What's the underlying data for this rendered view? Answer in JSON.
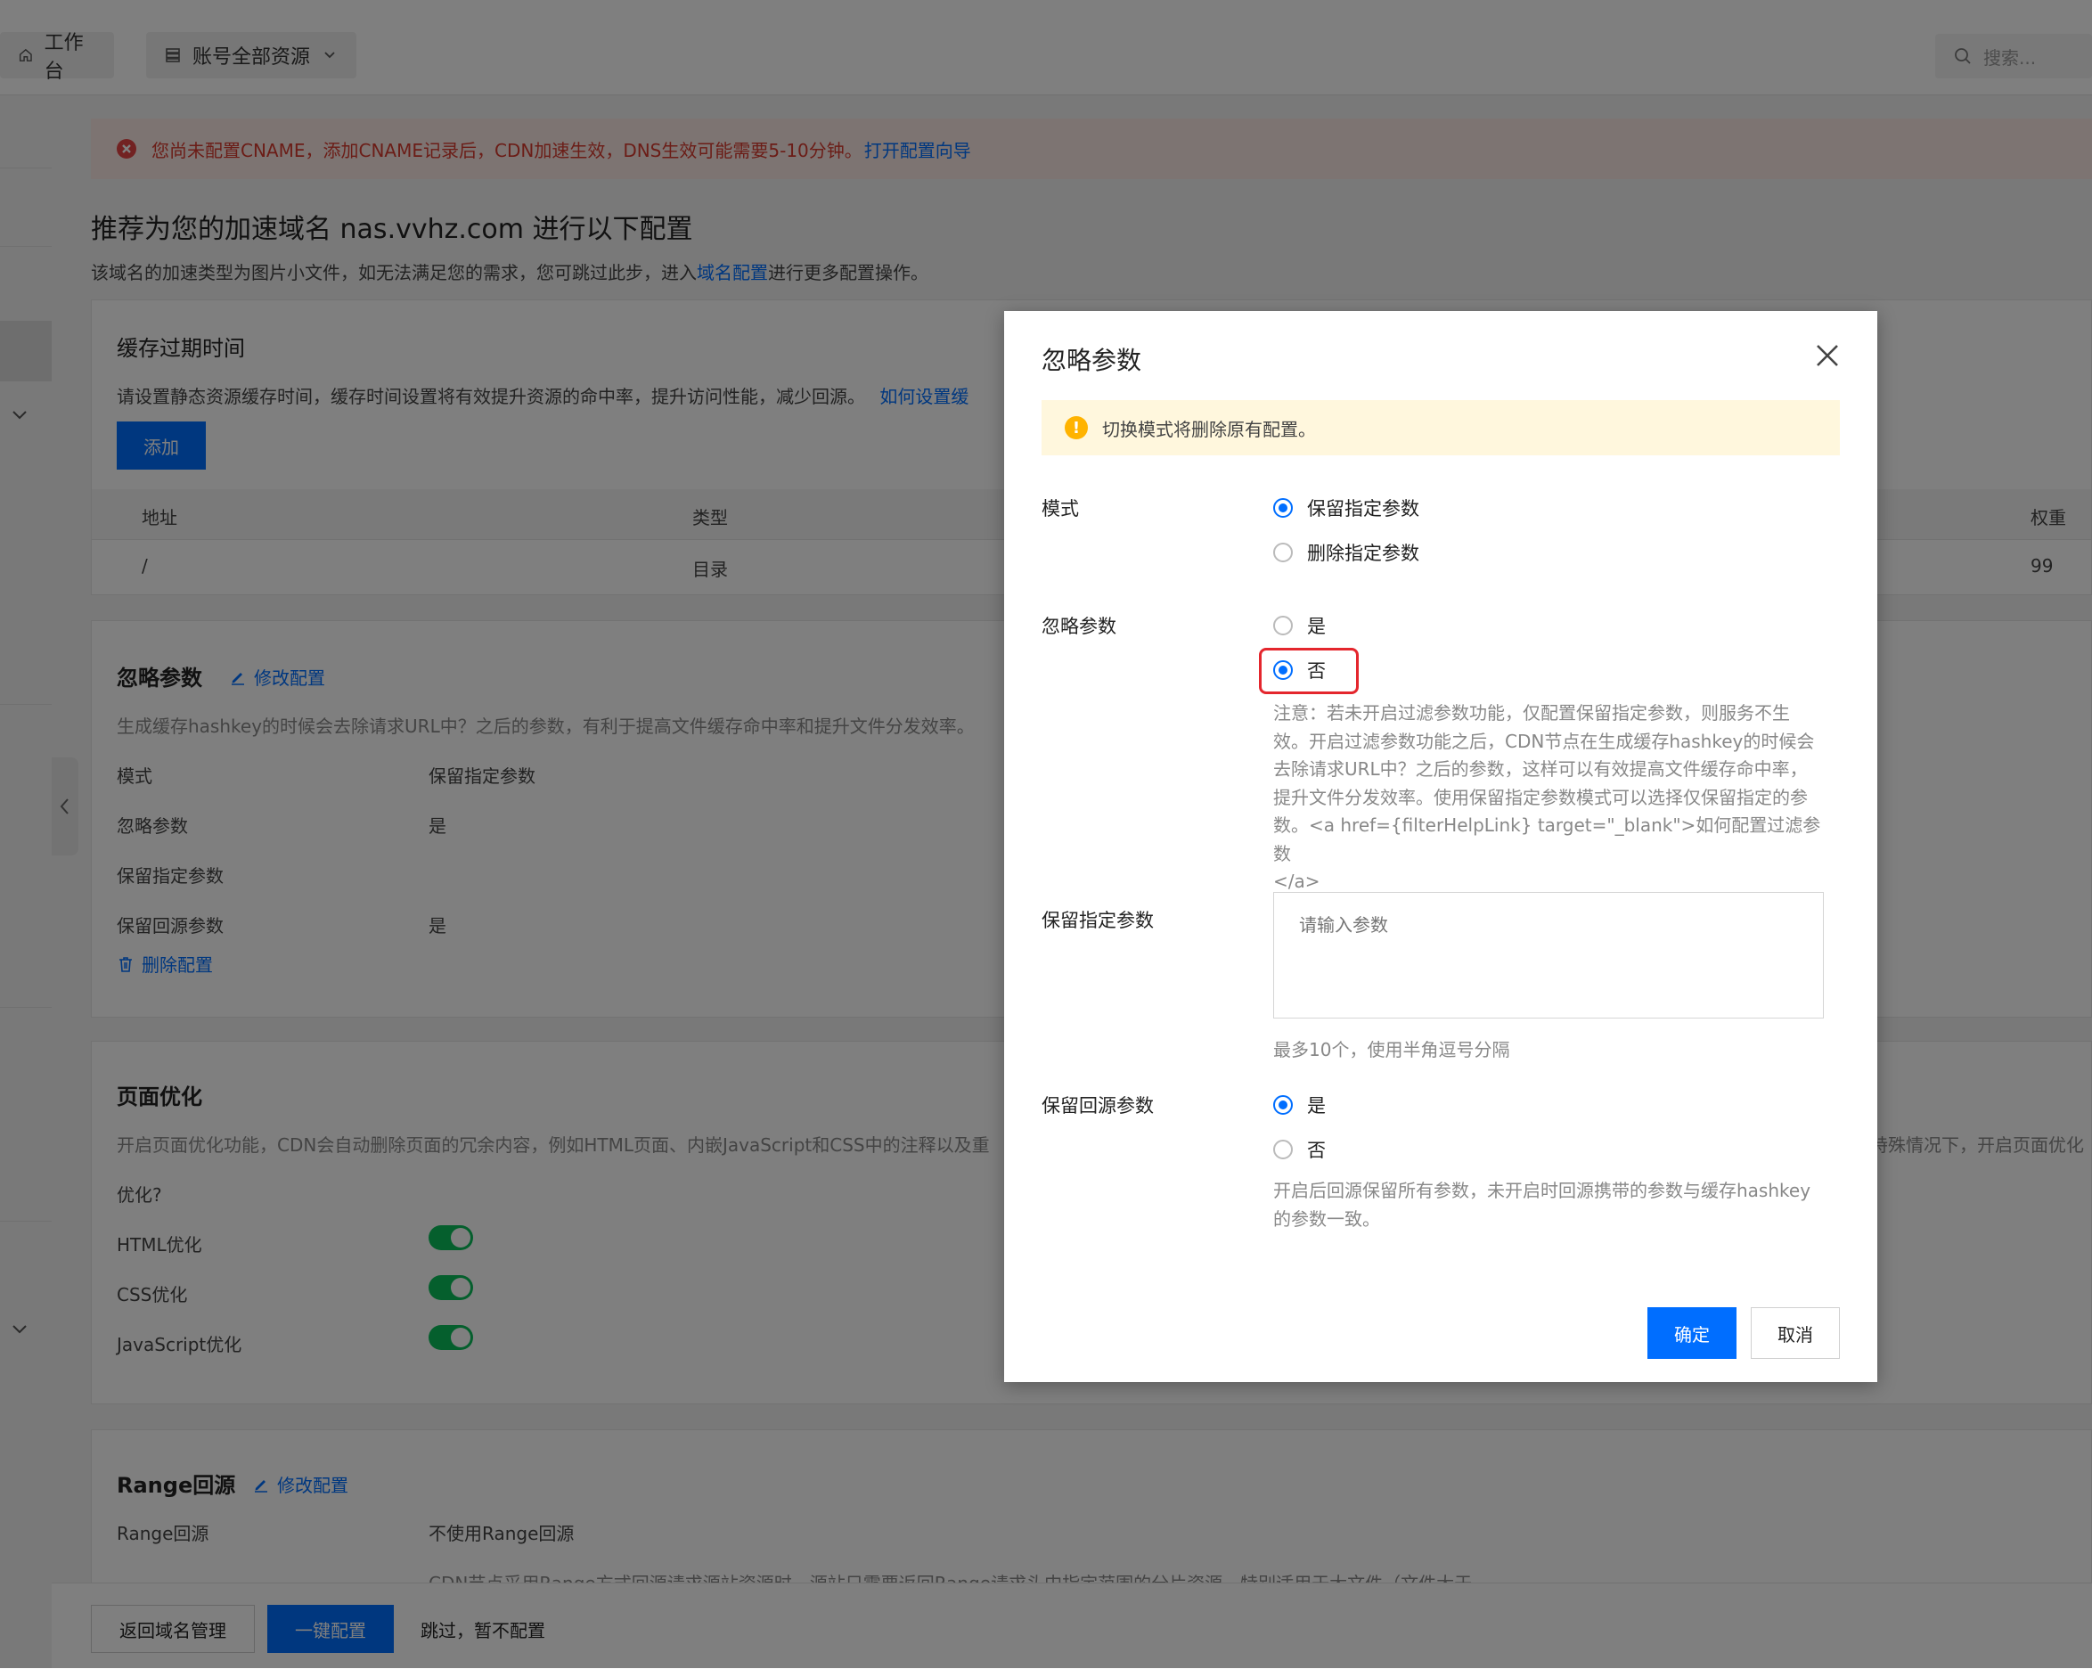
{
  "topbar": {
    "workbench": "工作台",
    "resources": "账号全部资源",
    "search_placeholder": "搜索..."
  },
  "alert": {
    "text": "您尚未配置CNAME，添加CNAME记录后，CDN加速生效，DNS生效可能需要5-10分钟。",
    "link": "打开配置向导"
  },
  "page": {
    "title": "推荐为您的加速域名 nas.vvhz.com 进行以下配置",
    "subtitle_pre": "该域名的加速类型为图片小文件，如无法满足您的需求，您可跳过此步，进入",
    "subtitle_link": "域名配置",
    "subtitle_post": "进行更多配置操作。"
  },
  "cache": {
    "title": "缓存过期时间",
    "desc": "请设置静态资源缓存时间，缓存时间设置将有效提升资源的命中率，提升访问性能，减少回源。",
    "desc_link": "如何设置缓",
    "add_label": "添加",
    "columns": [
      "地址",
      "类型",
      "权重"
    ],
    "rows": [
      [
        "/",
        "目录",
        "99"
      ]
    ]
  },
  "ignore": {
    "title": "忽略参数",
    "edit": "修改配置",
    "desc": "生成缓存hashkey的时候会去除请求URL中？之后的参数，有利于提高文件缓存命中率和提升文件分发效率。",
    "rows": [
      {
        "label": "模式",
        "value": "保留指定参数"
      },
      {
        "label": "忽略参数",
        "value": "是"
      },
      {
        "label": "保留指定参数",
        "value": ""
      },
      {
        "label": "保留回源参数",
        "value": "是"
      }
    ],
    "delete": "删除配置"
  },
  "pageopt": {
    "title": "页面优化",
    "desc": "开启页面优化功能，CDN会自动删除页面的冗余内容，例如HTML页面、内嵌JavaScript和CSS中的注释以及重",
    "desc_tail": "特殊情况下，开启页面优化",
    "link": "优化?",
    "rows": [
      {
        "label": "HTML优化",
        "on": true
      },
      {
        "label": "CSS优化",
        "on": true
      },
      {
        "label": "JavaScript优化",
        "on": true
      }
    ]
  },
  "range": {
    "title": "Range回源",
    "edit": "修改配置",
    "label": "Range回源",
    "value": "不使用Range回源",
    "desc_cut": "CDN节点采用Range方式回源请求源站资源时，源站只需要返回Range请求头中指定范围的分片资源，特别适用于大文件（文件大于"
  },
  "footer": {
    "back": "返回域名管理",
    "oneclick": "一键配置",
    "skip": "跳过，暂不配置"
  },
  "modal": {
    "title": "忽略参数",
    "warning": "切换模式将删除原有配置。",
    "mode_label": "模式",
    "mode_options": [
      "保留指定参数",
      "删除指定参数"
    ],
    "mode_selected": 0,
    "ignore_label": "忽略参数",
    "ignore_options": [
      "是",
      "否"
    ],
    "ignore_selected": 1,
    "note_lines": [
      "注意：若未开启过滤参数功能，仅配置保留指定参数，则服务不生",
      "效。开启过滤参数功能之后，CDN节点在生成缓存hashkey的时候会",
      "去除请求URL中？之后的参数，这样可以有效提高文件缓存命中率，",
      "提升文件分发效率。使用保留指定参数模式可以选择仅保留指定的参",
      "数。<a href={filterHelpLink} target=\"_blank\">如何配置过滤参数",
      "</a>"
    ],
    "keep_label": "保留指定参数",
    "keep_placeholder": "请输入参数",
    "keep_hint": "最多10个，使用半角逗号分隔",
    "origin_label": "保留回源参数",
    "origin_options": [
      "是",
      "否"
    ],
    "origin_selected": 0,
    "origin_note_lines": [
      "开启后回源保留所有参数，未开启时回源携带的参数与缓存hashkey",
      "的参数一致。"
    ],
    "ok": "确定",
    "cancel": "取消"
  }
}
